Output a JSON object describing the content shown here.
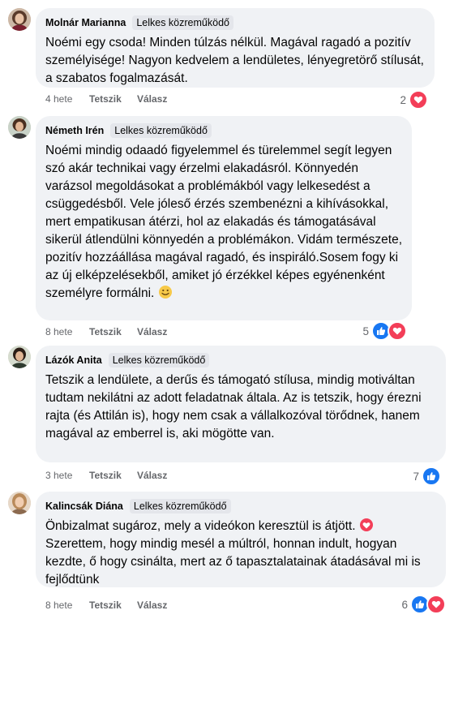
{
  "comments": [
    {
      "author": "Molnár Marianna",
      "badge": "Lelkes közreműködő",
      "text": "Noémi egy csoda! Minden túlzás nélkül. Magával ragadó a pozitív személyisége! Nagyon kedvelem a lendületes, lényegretörő stílusát, a szabatos fogalmazását.",
      "time": "4 hete",
      "like_label": "Tetszik",
      "reply_label": "Válasz",
      "reaction_count": "2",
      "reactions": [
        "heart-icon"
      ]
    },
    {
      "author": "Németh Irén",
      "badge": "Lelkes közreműködő",
      "text": "Noémi mindig odaadó figyelemmel és türelemmel segít legyen szó akár technikai vagy érzelmi elakadásról. Könnyedén varázsol megoldásokat a problémákból vagy lelkesedést a csüggedésből. Vele jóleső érzés szembenézni a kihívásokkal, mert empatikusan átérzi, hol az elakadás és támogatásával sikerül átlendülni könnyedén a problémákon. Vidám természete, pozitív hozzáállása magával ragadó, és inspiráló.Sosem fogy ki az új elképzelésekből, amiket jó érzékkel képes egyénenként személyre formálni.",
      "emoji": "smiley-emoji",
      "time": "8 hete",
      "like_label": "Tetszik",
      "reply_label": "Válasz",
      "reaction_count": "5",
      "reactions": [
        "thumbs-up-icon",
        "heart-icon"
      ]
    },
    {
      "author": "Lázók Anita",
      "badge": "Lelkes közreműködő",
      "text": "Tetszik a lendülete, a derűs és támogató stílusa, mindig motiváltan tudtam nekilátni az adott feladatnak általa. Az is tetszik, hogy érezni rajta (és Attilán is), hogy nem csak a vállalkozóval törődnek, hanem magával az emberrel is, aki mögötte van.",
      "time": "3 hete",
      "like_label": "Tetszik",
      "reply_label": "Válasz",
      "reaction_count": "7",
      "reactions": [
        "thumbs-up-icon"
      ]
    },
    {
      "author": "Kalincsák Diána",
      "badge": "Lelkes közreműködő",
      "text_before": "Önbizalmat sugároz, mely a videókon keresztül is átjött.",
      "text_after": "Szerettem, hogy mindig mesél a múltról, honnan indult, hogyan kezdte, ő hogy csinálta, mert az ő tapasztalatainak átadásával mi is fejlődtünk",
      "emoji": "heart-emoji",
      "time": "8 hete",
      "like_label": "Tetszik",
      "reply_label": "Válasz",
      "reaction_count": "6",
      "reactions": [
        "thumbs-up-icon",
        "heart-icon"
      ]
    }
  ],
  "colors": {
    "bubble": "#f0f2f5",
    "badge": "#e4e6eb",
    "like_blue": "#1877f2",
    "love_red": "#f33e58",
    "meta_gray": "#65676b"
  }
}
